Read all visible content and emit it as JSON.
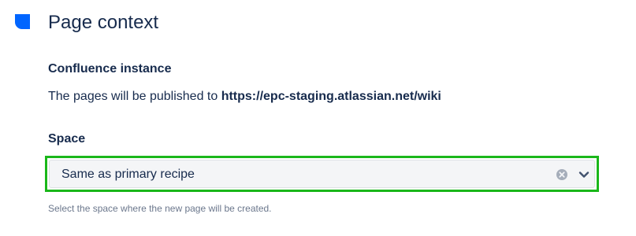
{
  "section": {
    "title": "Page context",
    "marker_icon": "section-marker-icon",
    "accent_color": "#0065ff"
  },
  "confluence_instance": {
    "label": "Confluence instance",
    "prefix": "The pages will be published to ",
    "url": "https://epc-staging.atlassian.net/wiki"
  },
  "space": {
    "label": "Space",
    "selected_value": "Same as primary recipe",
    "clear_icon": "clear-icon",
    "dropdown_icon": "chevron-down-icon",
    "helper_text": "Select the space where the new page will be created.",
    "highlight_color": "#1ab71a"
  }
}
